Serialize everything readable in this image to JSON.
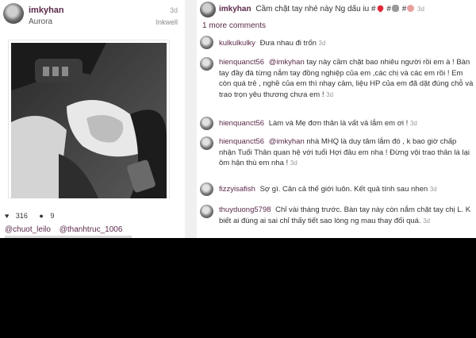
{
  "post": {
    "username": "imkyhan",
    "time": "3d",
    "location": "Aurora",
    "filter": "Inkwell",
    "likes": "316",
    "comments_count": "9",
    "tags": [
      "@chuot_leilo",
      "@thanhtruc_1006"
    ]
  },
  "caption": {
    "username": "imkyhan",
    "text": "Cầm chặt tay nhé này Ng dấu iu #",
    "hash1": "#",
    "hash2": "#",
    "time": "3d"
  },
  "more_comments_label": "1 more comments",
  "comments": [
    {
      "user": "kulkulkulky",
      "mention": "",
      "text": "Đưa nhau đi trốn",
      "time": "3d"
    },
    {
      "user": "hienquanct56",
      "mention": "@imkyhan",
      "text": "tay này cầm chặt bao nhiêu người rồi em à ! Bàn tay đầy đà từng nắm tay đồng nghiệp của em ,các chị và các em rồi ! Em còn quá trẻ , nghề của em thì nhạy cảm, liệu HP của em đã dặt đúng chỗ và trao trọn yêu thương chưa em !",
      "time": "3d"
    },
    {
      "user": "hienquanct56",
      "mention": "",
      "text": "Làm và Mẹ đơn thân là vất vả lắm em ơi !",
      "time": "3d"
    },
    {
      "user": "hienquanct56",
      "mention": "@imkyhan",
      "text": "nhà MHQ là duy tâm lắm đó , k bao giờ chấp nhận Tuổi Thân quan hệ với tuổi Hợi đâu em nha ! Đừng vội trao thân là lại ôm hận thù em nha !",
      "time": "3d"
    },
    {
      "user": "fizzyisafish",
      "mention": "",
      "text": "Sợ gì. Cân cả thế giới luôn. Kết quả tính sau nhen",
      "time": "3d"
    },
    {
      "user": "thuyduong5798",
      "mention": "",
      "text": "Chỉ vài tháng trước. Bàn tay này còn nắm chặt tay chị L. K biết ai đúng ai sai chỉ thấy tiết sao lòng ng mau thay đổi quá.",
      "time": "3d"
    }
  ]
}
